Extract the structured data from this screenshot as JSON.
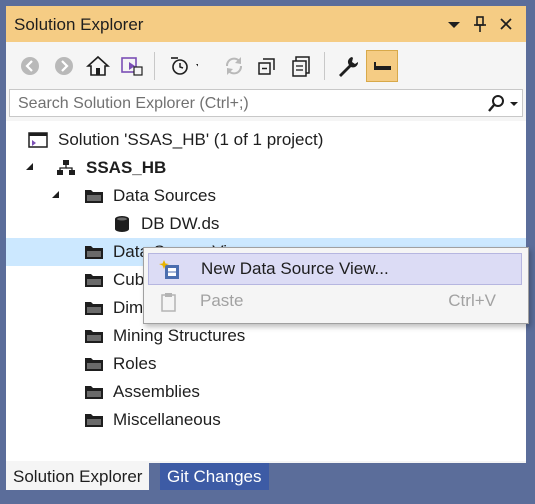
{
  "panel": {
    "title": "Solution Explorer",
    "title_icons": [
      "dropdown-icon",
      "pin-icon",
      "close-icon"
    ]
  },
  "toolbar": {
    "buttons": [
      "back-icon",
      "forward-icon",
      "home-icon",
      "vs-switch-icon",
      "pending-changes-filter-icon",
      "sync-icon",
      "collapse-all-icon",
      "show-all-files-icon",
      "properties-icon",
      "preview-icon"
    ]
  },
  "search": {
    "placeholder": "Search Solution Explorer (Ctrl+;)"
  },
  "tree": {
    "solution": "Solution 'SSAS_HB' (1 of 1 project)",
    "project": "SSAS_HB",
    "items": [
      {
        "label": "Data Sources",
        "icon": "folder-icon"
      },
      {
        "label": "DB DW.ds",
        "icon": "database-icon"
      },
      {
        "label": "Data Source Views",
        "icon": "folder-icon"
      },
      {
        "label": "Cubes",
        "icon": "folder-icon"
      },
      {
        "label": "Dimensions",
        "icon": "folder-icon"
      },
      {
        "label": "Mining Structures",
        "icon": "folder-icon"
      },
      {
        "label": "Roles",
        "icon": "folder-icon"
      },
      {
        "label": "Assemblies",
        "icon": "folder-icon"
      },
      {
        "label": "Miscellaneous",
        "icon": "folder-icon"
      }
    ]
  },
  "context_menu": {
    "items": [
      {
        "label": "New Data Source View...",
        "shortcut": "",
        "enabled": true
      },
      {
        "label": "Paste",
        "shortcut": "Ctrl+V",
        "enabled": false
      }
    ]
  },
  "tabs": [
    "Solution Explorer",
    "Git Changes"
  ],
  "colors": {
    "title_bar": "#f5cc84",
    "selection": "#cce8ff",
    "frame": "#5b6d9a",
    "tab_inactive": "#3d5ba5"
  }
}
